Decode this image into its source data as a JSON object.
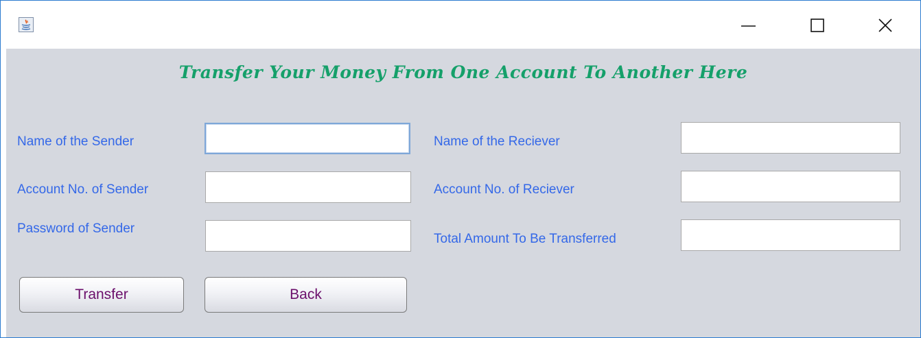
{
  "window": {
    "title": "",
    "app_icon": "java-app-icon",
    "controls": {
      "minimize": "minimize-icon",
      "maximize": "maximize-icon",
      "close": "close-icon"
    }
  },
  "heading": "Transfer Your Money From One Account To Another Here",
  "sender": {
    "name_label": "Name of the Sender",
    "name_value": "",
    "account_label": "Account No. of Sender",
    "account_value": "",
    "password_label": "Password of Sender",
    "password_value": ""
  },
  "receiver": {
    "name_label": "Name of the Reciever",
    "name_value": "",
    "account_label": "Account No. of Reciever",
    "account_value": "",
    "amount_label": "Total Amount To Be Transferred",
    "amount_value": ""
  },
  "buttons": {
    "transfer": "Transfer",
    "back": "Back"
  },
  "colors": {
    "heading": "#15a06a",
    "label": "#3468e8",
    "button_text": "#6b0f6b",
    "panel_bg": "#d5d8df",
    "window_border": "#2b7bd0"
  }
}
